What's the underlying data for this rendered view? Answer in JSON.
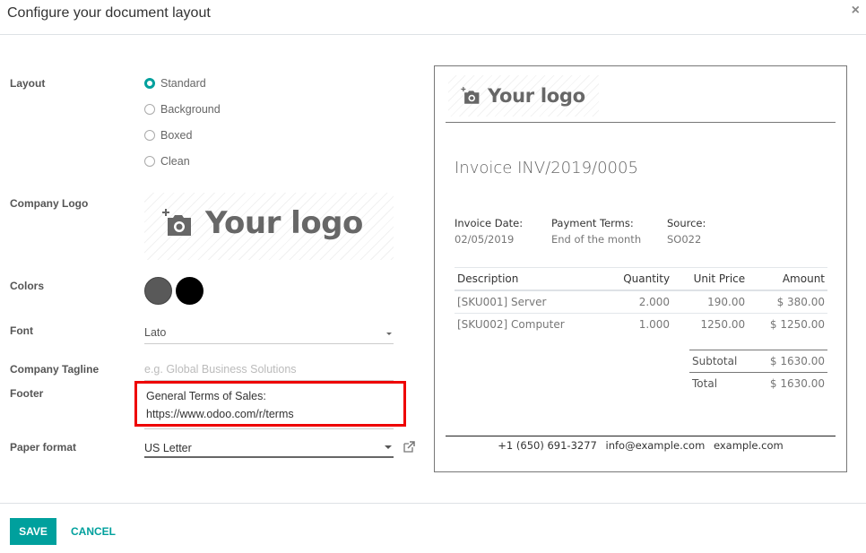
{
  "dialog": {
    "title": "Configure your document layout",
    "close_icon": "close-icon"
  },
  "form": {
    "layout": {
      "label": "Layout",
      "options": [
        {
          "label": "Standard",
          "checked": true
        },
        {
          "label": "Background",
          "checked": false
        },
        {
          "label": "Boxed",
          "checked": false
        },
        {
          "label": "Clean",
          "checked": false
        }
      ]
    },
    "company_logo": {
      "label": "Company Logo",
      "placeholder_text": "Your logo",
      "icon": "add-photo-icon"
    },
    "colors": {
      "label": "Colors",
      "primary": "#595959",
      "secondary": "#000000"
    },
    "font": {
      "label": "Font",
      "value": "Lato"
    },
    "tagline": {
      "label": "Company Tagline",
      "placeholder": "e.g. Global Business Solutions",
      "value": ""
    },
    "footer": {
      "label": "Footer",
      "line1": "General Terms of Sales:",
      "line2": "https://www.odoo.com/r/terms"
    },
    "paper_format": {
      "label": "Paper format",
      "value": "US Letter",
      "link_icon": "external-link-icon"
    }
  },
  "preview": {
    "logo_text": "Your logo",
    "invoice_title": "Invoice INV/2019/0005",
    "info": [
      {
        "key": "Invoice Date:",
        "value": "02/05/2019"
      },
      {
        "key": "Payment Terms:",
        "value": "End of the month"
      },
      {
        "key": "Source:",
        "value": "SO022"
      }
    ],
    "table": {
      "headers": [
        "Description",
        "Quantity",
        "Unit Price",
        "Amount"
      ],
      "rows": [
        [
          "[SKU001] Server",
          "2.000",
          "190.00",
          "$ 380.00"
        ],
        [
          "[SKU002] Computer",
          "1.000",
          "1250.00",
          "$ 1250.00"
        ]
      ]
    },
    "totals": [
      {
        "label": "Subtotal",
        "value": "$ 1630.00"
      },
      {
        "label": "Total",
        "value": "$ 1630.00"
      }
    ],
    "footer": {
      "phone": "+1 (650) 691-3277",
      "email": "info@example.com",
      "website": "example.com"
    }
  },
  "buttons": {
    "save": "SAVE",
    "cancel": "CANCEL"
  },
  "colors": {
    "accent": "#00A09D",
    "highlight": "#EE0000"
  }
}
